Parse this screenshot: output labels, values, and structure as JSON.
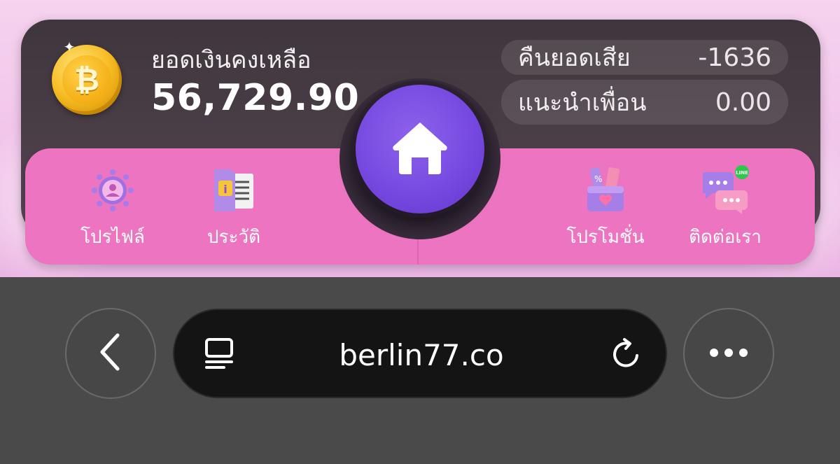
{
  "wallet": {
    "balance_label": "ยอดเงินคงเหลือ",
    "balance_value": "56,729.90",
    "coin_icon": "bitcoin-coin-icon",
    "stats": [
      {
        "label": "คืนยอดเสีย",
        "value": "-1636"
      },
      {
        "label": "แนะนำเพื่อน",
        "value": "0.00"
      }
    ]
  },
  "nav": {
    "items": [
      {
        "label": "โปรไฟล์",
        "icon": "profile-icon"
      },
      {
        "label": "ประวัติ",
        "icon": "history-document-icon"
      },
      {
        "label": "โปรโมชั่น",
        "icon": "promotion-gift-icon"
      },
      {
        "label": "ติดต่อเรา",
        "icon": "contact-chat-icon"
      }
    ],
    "home_icon": "home-icon"
  },
  "browser": {
    "url": "berlin77.co",
    "back_icon": "chevron-left-icon",
    "reader_icon": "reader-mode-icon",
    "reload_icon": "reload-icon",
    "more_icon": "more-dots-icon"
  },
  "colors": {
    "card_dark": "#3f363d",
    "nav_pink": "#ec74c0",
    "home_purple": "#7448df",
    "coin_gold": "#f8c02a",
    "browser_bg": "#4a4a4a",
    "url_bar": "#141414"
  }
}
